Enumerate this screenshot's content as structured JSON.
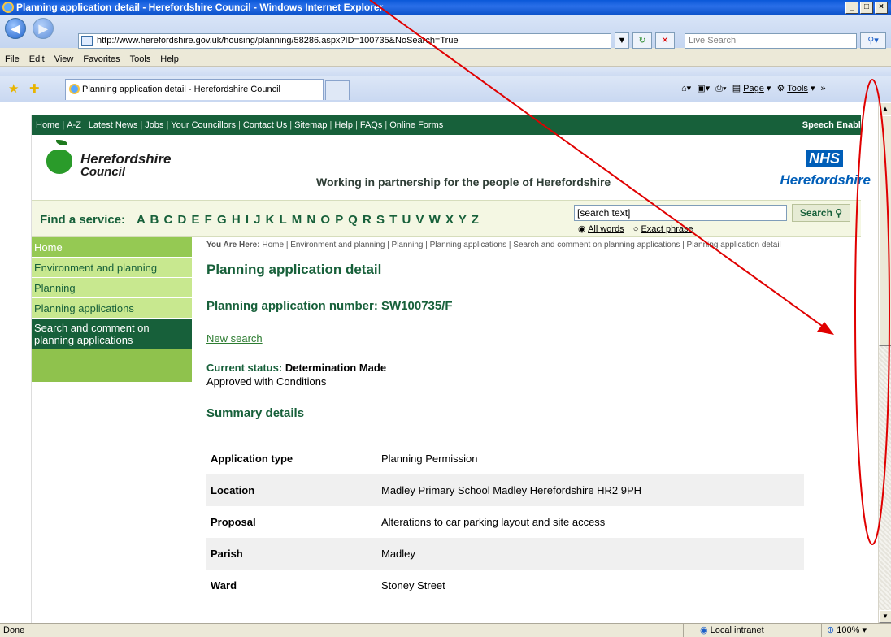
{
  "window": {
    "title": "Planning application detail - Herefordshire Council - Windows Internet Explorer",
    "url": "http://www.herefordshire.gov.uk/housing/planning/58286.aspx?ID=100735&NoSearch=True",
    "live_search_placeholder": "Live Search",
    "menu": [
      "File",
      "Edit",
      "View",
      "Favorites",
      "Tools",
      "Help"
    ],
    "tab_title": "Planning application detail - Herefordshire Council",
    "cmd": {
      "page": "Page",
      "tools": "Tools"
    },
    "status_left": "Done",
    "zone": "Local intranet",
    "zoom": "100%"
  },
  "site": {
    "topnav": [
      "Home",
      "A-Z",
      "Latest News",
      "Jobs",
      "Your Councillors",
      "Contact Us",
      "Sitemap",
      "Help",
      "FAQs",
      "Online Forms"
    ],
    "speech": "Speech Enable",
    "logo_line1": "Herefordshire",
    "logo_line2": "Council",
    "tagline": "Working in partnership for the people of Herefordshire",
    "nhs_badge": "NHS",
    "nhs_name": "Herefordshire",
    "find_label": "Find a service:",
    "letters": "A B C D E F G H I J K L M N O P Q R S T U V W X Y Z",
    "search_value": "[search text]",
    "search_button": "Search",
    "radio_all": "All words",
    "radio_exact": "Exact phrase"
  },
  "sidebar": [
    {
      "label": "Home"
    },
    {
      "label": "Environment and planning"
    },
    {
      "label": "Planning"
    },
    {
      "label": "Planning applications"
    },
    {
      "label": "Search and comment on planning applications"
    }
  ],
  "main": {
    "crumb_prefix": "You Are Here:",
    "crumb": "Home | Environment and planning | Planning | Planning applications | Search and comment on planning applications | Planning application detail",
    "title": "Planning application detail",
    "app_number": "Planning application number: SW100735/F",
    "new_search": "New search",
    "status_label": "Current status:",
    "status_value": "Determination Made",
    "status_detail": "Approved with Conditions",
    "summary_heading": "Summary details",
    "rows": [
      {
        "k": "Application type",
        "v": "Planning Permission"
      },
      {
        "k": "Location",
        "v": "Madley Primary School Madley Herefordshire HR2 9PH"
      },
      {
        "k": "Proposal",
        "v": "Alterations to car parking layout and site access"
      },
      {
        "k": "Parish",
        "v": "Madley"
      },
      {
        "k": "Ward",
        "v": "Stoney Street"
      }
    ]
  },
  "annotation_color": "#e00000"
}
